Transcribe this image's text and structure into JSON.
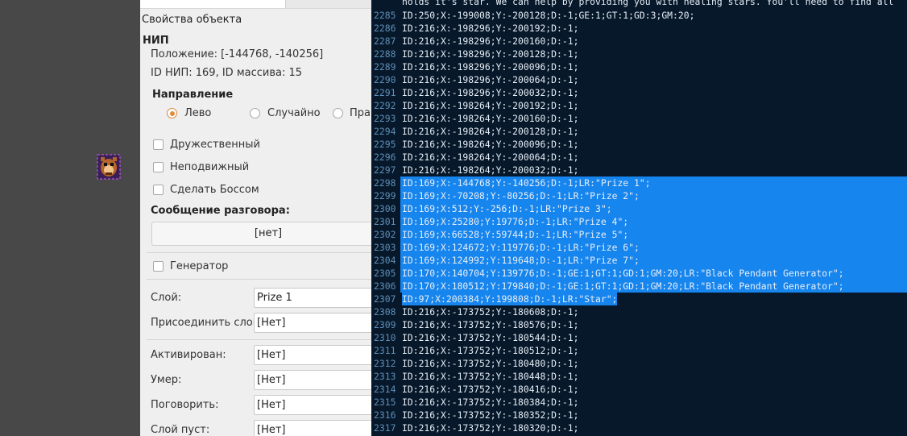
{
  "panel": {
    "title": "Свойства объекта",
    "npc_header": "НИП",
    "position_text": "Положение: [-144768, -140256]",
    "ids_text": "ID НИП: 169, ID массива: 15",
    "direction_header": "Направление",
    "direction_options": [
      "Лево",
      "Случайно",
      "Право"
    ],
    "direction_selected": "Лево",
    "checkboxes": {
      "friendly": "Дружественный",
      "immobile": "Неподвижный",
      "boss": "Сделать Боссом"
    },
    "talk_header": "Сообщение разговора:",
    "talk_value": "[нет]",
    "generator_label": "Генератор",
    "fields": [
      {
        "label": "Слой:",
        "value": "Prize 1"
      },
      {
        "label": "Присоединить слой:",
        "value": "[Нет]"
      },
      {
        "label": "Активирован:",
        "value": "[Нет]"
      },
      {
        "label": "Умер:",
        "value": "[Нет]"
      },
      {
        "label": "Поговорить:",
        "value": "[Нет]"
      },
      {
        "label": "Слой пуст:",
        "value": "[Нет]"
      }
    ]
  },
  "editor": {
    "top_partial": "holds it's star. We can help by providing you with healing stars. You'll need to find all",
    "highlight_color": "#1785ee",
    "lines": [
      {
        "n": "2285",
        "text": "ID:250;X:-199008;Y:-200128;D:-1;GE:1;GT:1;GD:3;GM:20;",
        "sel": false
      },
      {
        "n": "2286",
        "text": "ID:216;X:-198296;Y:-200192;D:-1;",
        "sel": false
      },
      {
        "n": "2287",
        "text": "ID:216;X:-198296;Y:-200160;D:-1;",
        "sel": false
      },
      {
        "n": "2288",
        "text": "ID:216;X:-198296;Y:-200128;D:-1;",
        "sel": false
      },
      {
        "n": "2289",
        "text": "ID:216;X:-198296;Y:-200096;D:-1;",
        "sel": false
      },
      {
        "n": "2290",
        "text": "ID:216;X:-198296;Y:-200064;D:-1;",
        "sel": false
      },
      {
        "n": "2291",
        "text": "ID:216;X:-198296;Y:-200032;D:-1;",
        "sel": false
      },
      {
        "n": "2292",
        "text": "ID:216;X:-198264;Y:-200192;D:-1;",
        "sel": false
      },
      {
        "n": "2293",
        "text": "ID:216;X:-198264;Y:-200160;D:-1;",
        "sel": false
      },
      {
        "n": "2294",
        "text": "ID:216;X:-198264;Y:-200128;D:-1;",
        "sel": false
      },
      {
        "n": "2295",
        "text": "ID:216;X:-198264;Y:-200096;D:-1;",
        "sel": false
      },
      {
        "n": "2296",
        "text": "ID:216;X:-198264;Y:-200064;D:-1;",
        "sel": false
      },
      {
        "n": "2297",
        "text": "ID:216;X:-198264;Y:-200032;D:-1;",
        "sel": false
      },
      {
        "n": "2298",
        "text": "ID:169;X:-144768;Y:-140256;D:-1;LR:\"Prize 1\";",
        "sel": "full"
      },
      {
        "n": "2299",
        "text": "ID:169;X:-70208;Y:-80256;D:-1;LR:\"Prize 2\";",
        "sel": "full"
      },
      {
        "n": "2300",
        "text": "ID:169;X:512;Y:-256;D:-1;LR:\"Prize 3\";",
        "sel": "full"
      },
      {
        "n": "2301",
        "text": "ID:169;X:25280;Y:19776;D:-1;LR:\"Prize 4\";",
        "sel": "full"
      },
      {
        "n": "2302",
        "text": "ID:169;X:66528;Y:59744;D:-1;LR:\"Prize 5\";",
        "sel": "full"
      },
      {
        "n": "2303",
        "text": "ID:169;X:124672;Y:119776;D:-1;LR:\"Prize 6\";",
        "sel": "full"
      },
      {
        "n": "2304",
        "text": "ID:169;X:124992;Y:119648;D:-1;LR:\"Prize 7\";",
        "sel": "full"
      },
      {
        "n": "2305",
        "text": "ID:170;X:140704;Y:139776;D:-1;GE:1;GT:1;GD:1;GM:20;LR:\"Black Pendant Generator\";",
        "sel": "full"
      },
      {
        "n": "2306",
        "text": "ID:170;X:180512;Y:179840;D:-1;GE:1;GT:1;GD:1;GM:20;LR:\"Black Pendant Generator\";",
        "sel": "full"
      },
      {
        "n": "2307",
        "text": "ID:97;X:200384;Y:199808;D:-1;LR:\"Star\";",
        "sel": "text"
      },
      {
        "n": "2308",
        "text": "ID:216;X:-173752;Y:-180608;D:-1;",
        "sel": false
      },
      {
        "n": "2309",
        "text": "ID:216;X:-173752;Y:-180576;D:-1;",
        "sel": false
      },
      {
        "n": "2310",
        "text": "ID:216;X:-173752;Y:-180544;D:-1;",
        "sel": false
      },
      {
        "n": "2311",
        "text": "ID:216;X:-173752;Y:-180512;D:-1;",
        "sel": false
      },
      {
        "n": "2312",
        "text": "ID:216;X:-173752;Y:-180480;D:-1;",
        "sel": false
      },
      {
        "n": "2313",
        "text": "ID:216;X:-173752;Y:-180448;D:-1;",
        "sel": false
      },
      {
        "n": "2314",
        "text": "ID:216;X:-173752;Y:-180416;D:-1;",
        "sel": false
      },
      {
        "n": "2315",
        "text": "ID:216;X:-173752;Y:-180384;D:-1;",
        "sel": false
      },
      {
        "n": "2316",
        "text": "ID:216;X:-173752;Y:-180352;D:-1;",
        "sel": false
      },
      {
        "n": "2317",
        "text": "ID:216;X:-173752;Y:-180320;D:-1;",
        "sel": false
      }
    ]
  }
}
